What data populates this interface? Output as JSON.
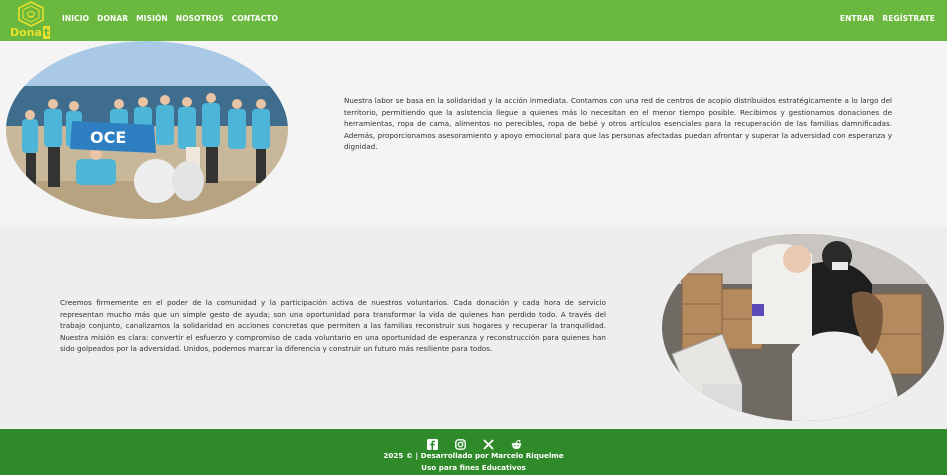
{
  "brand": {
    "name_main": "Dona",
    "name_accent": "t"
  },
  "nav": {
    "left": [
      "INICIO",
      "DONAR",
      "MISIÓN",
      "NOSOTROS",
      "CONTACTO"
    ],
    "right": [
      "ENTRAR",
      "REGÍSTRATE"
    ]
  },
  "section1": {
    "text": "Nuestra labor se basa en la solidaridad y la acción inmediata. Contamos con una red de centros de acopio distribuidos estratégicamente a lo largo del territorio, permitiendo que la asistencia llegue a quienes más lo necesitan en el menor tiempo posible. Recibimos y gestionamos donaciones de herramientas, ropa de cama, alimentos no perecibles, ropa de bebé y otros artículos esenciales para la recuperación de las familias damnificadas. Además, proporcionamos asesoramiento y apoyo emocional para que las personas afectadas puedan afrontar y superar la adversidad con esperanza y dignidad.",
    "image": "volunteers-beach-photo"
  },
  "section2": {
    "text": "Creemos firmemente en el poder de la comunidad y la participación activa de nuestros voluntarios. Cada donación y cada hora de servicio representan mucho más que un simple gesto de ayuda; son una oportunidad para transformar la vida de quienes han perdido todo. A través del trabajo conjunto, canalizamos la solidaridad en acciones concretas que permiten a las familias reconstruir sus hogares y recuperar la tranquilidad. Nuestra misión es clara: convertir el esfuerzo y compromiso de cada voluntario en una oportunidad de esperanza y reconstrucción para quienes han sido golpeados por la adversidad. Unidos, podemos marcar la diferencia y construir un futuro más resiliente para todos.",
    "image": "volunteers-boxes-photo"
  },
  "footer": {
    "social_icons": [
      "facebook-icon",
      "instagram-icon",
      "x-icon",
      "reddit-icon"
    ],
    "line1": "2025 © | Desarrollado por Marcelo Riquelme",
    "line2": "Uso para fines Educativos"
  },
  "colors": {
    "navbar": "#6ab83e",
    "logo": "#e8e02c",
    "footer": "#2f8a2a",
    "text": "#333333"
  }
}
